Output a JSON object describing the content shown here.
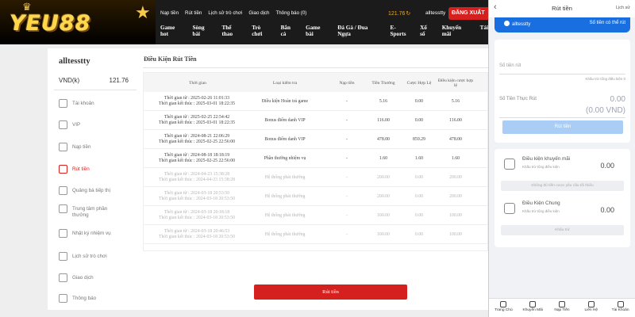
{
  "brand": {
    "logo_text": "YEU88",
    "crown": "♛",
    "star": "★"
  },
  "header": {
    "top_links": [
      "Nạp tiền",
      "Rút tiền",
      "Lịch sử trò chơi",
      "Giao dịch",
      "Thông báo (0)"
    ],
    "balance": "121.76",
    "refresh_icon": "↻",
    "username": "alltesstty",
    "logout_label": "ĐĂNG XUẤT",
    "main_nav": [
      "Game hot",
      "Sòng bài",
      "Thể thao",
      "Trò chơi",
      "Bắn cá",
      "Game bài",
      "Đá Gà / Đua Ngựa",
      "E-Sports",
      "Xổ số",
      "Khuyến mãi",
      "Tải"
    ]
  },
  "sidebar": {
    "username": "alltesstty",
    "currency_label": "VND(k)",
    "balance": "121.76",
    "items": [
      {
        "label": "Tài khoản",
        "icon": "account-icon"
      },
      {
        "label": "VIP",
        "icon": "vip-icon"
      },
      {
        "label": "Nạp tiền",
        "icon": "deposit-icon"
      },
      {
        "label": "Rút tiền",
        "icon": "withdraw-icon",
        "active": true
      },
      {
        "label": "Quảng bá tiếp thị",
        "icon": "promo-icon"
      },
      {
        "label": "Trung tâm phần thưởng",
        "icon": "reward-icon"
      },
      {
        "label": "Nhật ký nhiệm vụ",
        "icon": "mission-icon"
      },
      {
        "label": "Lịch sử trò chơi",
        "icon": "history-icon"
      },
      {
        "label": "Giao dịch",
        "icon": "transaction-icon"
      },
      {
        "label": "Thông báo",
        "icon": "notification-icon"
      }
    ]
  },
  "content": {
    "title": "Điều Kiện Rút Tiền",
    "columns": [
      "Thời gian",
      "Loại kiểm tra",
      "Nạp tiền",
      "Tiền Thưởng",
      "Cược Hợp Lệ",
      "Điều kiện cược hợp lệ"
    ],
    "rows": [
      {
        "start": "Thời gian từ : 2025-02-26 11:01:33",
        "end": "Thời gian kết thúc : 2025-03-01 18:22:35",
        "type": "Điều kiện Hoàn trả game",
        "deposit": "-",
        "bonus": "5.16",
        "valid_bet": "0.00",
        "condition": "5.16",
        "dim": false
      },
      {
        "start": "Thời gian từ : 2025-02-25 22:54:42",
        "end": "Thời gian kết thúc : 2025-03-01 18:22:35",
        "type": "Bonus điểm danh VIP",
        "deposit": "-",
        "bonus": "116.00",
        "valid_bet": "0.00",
        "condition": "116.00",
        "dim": false
      },
      {
        "start": "Thời gian từ : 2024-08-21 22:06:29",
        "end": "Thời gian kết thúc : 2025-02-25 22:56:00",
        "type": "Bonus điểm danh VIP",
        "deposit": "-",
        "bonus": "478.00",
        "valid_bet": "859.29",
        "condition": "478.00",
        "dim": false
      },
      {
        "start": "Thời gian từ : 2024-08-18 18:18:19",
        "end": "Thời gian kết thúc : 2025-02-25 22:56:00",
        "type": "Phần thưởng nhiệm vụ",
        "deposit": "-",
        "bonus": "1.60",
        "valid_bet": "1.60",
        "condition": "1.60",
        "dim": false
      },
      {
        "start": "Thời gian từ : 2024-04-23 15:38:28",
        "end": "Thời gian kết thúc : 2024-04-23 15:38:28",
        "type": "Hệ thống phát thưởng",
        "deposit": "-",
        "bonus": "200.00",
        "valid_bet": "0.00",
        "condition": "200.00",
        "dim": true
      },
      {
        "start": "Thời gian từ : 2024-03-18 20:53:50",
        "end": "Thời gian kết thúc : 2024-03-18 20:53:50",
        "type": "Hệ thống phát thưởng",
        "deposit": "-",
        "bonus": "200.00",
        "valid_bet": "0.00",
        "condition": "200.00",
        "dim": true
      },
      {
        "start": "Thời gian từ : 2024-03-18 20:18:18",
        "end": "Thời gian kết thúc : 2024-03-18 20:53:50",
        "type": "Hệ thống phát thưởng",
        "deposit": "-",
        "bonus": "100.00",
        "valid_bet": "0.00",
        "condition": "100.00",
        "dim": true
      },
      {
        "start": "Thời gian từ : 2024-03-18 20:46:53",
        "end": "Thời gian kết thúc : 2024-03-18 20:53:50",
        "type": "Hệ thống phát thưởng",
        "deposit": "-",
        "bonus": "100.00",
        "valid_bet": "0.00",
        "condition": "100.00",
        "dim": true
      }
    ],
    "button_label": "Rút tiền"
  },
  "phone": {
    "back_icon": "‹",
    "title": "Rút tiền",
    "history_link": "Lịch sử",
    "username": "alltesstty",
    "can_withdraw_label": "Số tiền có thể rút",
    "amount_placeholder": "Số tiền rút",
    "min_note": "Khấu trừ tổng điều kiện 0",
    "real_label": "Số Tiền Thực Rút",
    "real_value": "0.00",
    "real_value_vnd": "(0.00 VND)",
    "submit_label": "Rút tiền",
    "promo": {
      "title": "Điều kiện khuyến mãi",
      "sub": "Khấu trừ tổng điều kiện",
      "value": "0.00",
      "button": "Không đủ tiền cược yêu cầu tối thiểu"
    },
    "general": {
      "title": "Điều Kiện Chung",
      "sub": "Khấu trừ tổng điều kiện",
      "value": "0.00",
      "button": "Khấu trừ"
    },
    "tabs": [
      "Trang Chủ",
      "Khuyến Mãi",
      "Nạp Tiền",
      "Liên Hệ",
      "Tài Khoản"
    ]
  },
  "colors": {
    "accent_red": "#d52020",
    "brand_gold": "#ffd84a",
    "phone_blue": "#1a6fe0"
  }
}
